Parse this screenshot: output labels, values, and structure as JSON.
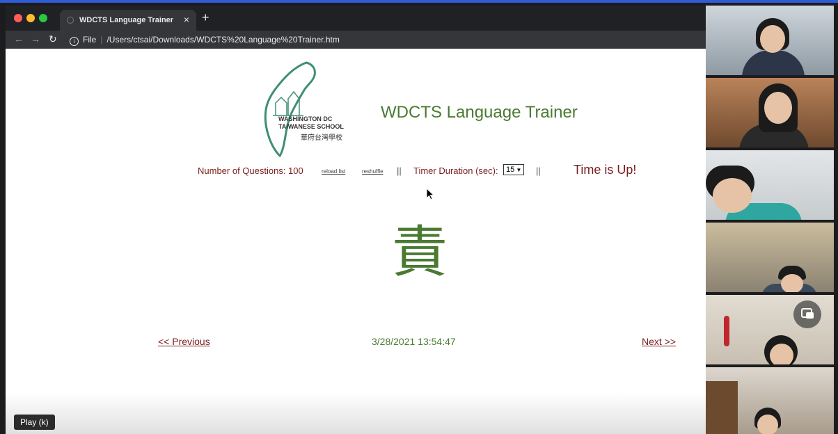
{
  "browser": {
    "tab_title": "WDCTS Language Trainer",
    "tab_close": "×",
    "new_tab": "+",
    "url_scheme": "File",
    "url_path": "/Users/ctsai/Downloads/WDCTS%20Language%20Trainer.htm"
  },
  "page": {
    "logo_text_line1": "WASHINGTON DC",
    "logo_text_line2": "TAIWANESE SCHOOL",
    "logo_text_line3": "華府台灣學校",
    "title": "WDCTS Language Trainer",
    "questions_label": "Number of Questions: 100",
    "reload_link": "reload list",
    "reshuffle_link": "reshuffle",
    "separator": "||",
    "timer_label": "Timer Duration (sec):",
    "timer_value": "15",
    "time_status": "Time is Up!",
    "character": "責",
    "prev_link": "<< Previous",
    "datetime": "3/28/2021 13:54:47",
    "next_link": "Next >>"
  },
  "player": {
    "play_tooltip": "Play (k)"
  },
  "colors": {
    "green": "#4a7a32",
    "maroon": "#7a1c1c",
    "logo_teal": "#3f8e76"
  }
}
